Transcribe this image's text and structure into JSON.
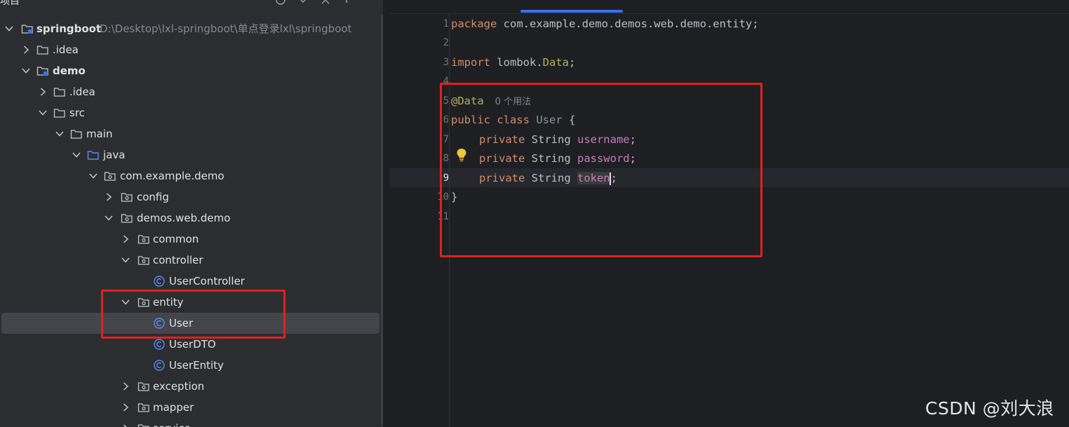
{
  "project_panel": {
    "title": "项目",
    "rows": [
      {
        "label": "springboot",
        "path_hint": "D:\\Desktop\\lxl-springboot\\单点登录lxl\\springboot"
      },
      {
        "label": ".idea"
      },
      {
        "label": "demo"
      },
      {
        "label": ".idea"
      },
      {
        "label": "src"
      },
      {
        "label": "main"
      },
      {
        "label": "java"
      },
      {
        "label": "com.example.demo"
      },
      {
        "label": "config"
      },
      {
        "label": "demos.web.demo"
      },
      {
        "label": "common"
      },
      {
        "label": "controller"
      },
      {
        "label": "UserController"
      },
      {
        "label": "entity"
      },
      {
        "label": "User"
      },
      {
        "label": "UserDTO"
      },
      {
        "label": "UserEntity"
      },
      {
        "label": "exception"
      },
      {
        "label": "mapper"
      },
      {
        "label": "service"
      }
    ]
  },
  "editor": {
    "line_numbers": [
      "1",
      "2",
      "3",
      "4",
      "5",
      "6",
      "7",
      "8",
      "9",
      "10",
      "11"
    ],
    "current_line": "9",
    "code": {
      "l1_kw": "package",
      "l1_rest": " com.example.demo.demos.web.demo.entity;",
      "l3_kw": "import",
      "l3_pkg": " lombok.",
      "l3_cls": "Data",
      "l3_end": ";",
      "l5_ann": "@Data",
      "l5_hint": "0 个用法",
      "l6_kw": "public class",
      "l6_name": " User",
      "l6_end": " {",
      "field_kw": "private",
      "field_type": " String ",
      "f1_name": "username",
      "f2_name": "password",
      "f3_name": "token",
      "semicolon": ";",
      "l10": "}"
    }
  },
  "watermark": "CSDN @刘大浪",
  "colors": {
    "highlight_box": "#e3201c",
    "keyword": "#cf8e6d",
    "annotation": "#b3ae60",
    "field": "#c77dbb",
    "accent": "#3574f0"
  }
}
